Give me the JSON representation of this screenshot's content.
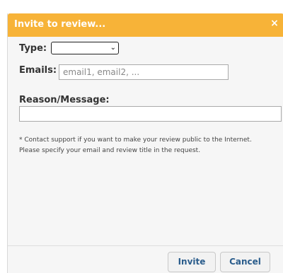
{
  "dialog": {
    "title": "Invite to review...",
    "close_icon": "×",
    "accent_color": "#f7b338"
  },
  "form": {
    "type_label": "Type:",
    "type_selected": "",
    "type_chevron": "⌄",
    "emails_label": "Emails:",
    "emails_value": "",
    "emails_placeholder": "email1, email2, ...",
    "reason_label": "Reason/Message:",
    "reason_value": ""
  },
  "note": {
    "line1": "* Contact support if you want to make your review public to the Internet.",
    "line2": "Please specify your email and review title in the request."
  },
  "buttons": {
    "invite_label": "Invite",
    "cancel_label": "Cancel"
  }
}
